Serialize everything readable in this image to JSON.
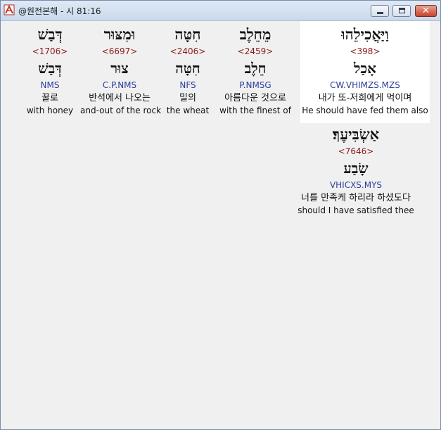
{
  "window": {
    "title": "@원전본해 - 시 81:16"
  },
  "words": [
    {
      "hebrew": "וַיַּאֲכִילֵהוּ",
      "strong": "<398>",
      "lemma": "אָכַל",
      "morph": "CW.VHIMZS.MZS",
      "korean": "내가 또-저희에게 먹이며",
      "english": "He should have fed them also"
    },
    {
      "hebrew": "מֵחֵלֶב",
      "strong": "<2459>",
      "lemma": "חֵלֶב",
      "morph": "P.NMSG",
      "korean": "아름다운 것으로",
      "english": "with the finest of"
    },
    {
      "hebrew": "חִטָּה",
      "strong": "<2406>",
      "lemma": "חִטָּה",
      "morph": "NFS",
      "korean": "밀의",
      "english": "the wheat"
    },
    {
      "hebrew": "וּמִצּוּר",
      "strong": "<6697>",
      "lemma": "צוּר",
      "morph": "C.P.NMS",
      "korean": "반석에서 나오는",
      "english": "and-out of the rock"
    },
    {
      "hebrew": "דְּבַשׁ",
      "strong": "<1706>",
      "lemma": "דְּבַשׁ",
      "morph": "NMS",
      "korean": "꿀로",
      "english": "with honey"
    },
    {
      "hebrew": "אַשְׂבִּיעֶךָ׃",
      "strong": "<7646>",
      "lemma": "שָׂבַע",
      "morph": "VHICXS.MYS",
      "korean": "너를 만족케 하리라 하셨도다",
      "english": "should I have satisfied thee"
    }
  ]
}
